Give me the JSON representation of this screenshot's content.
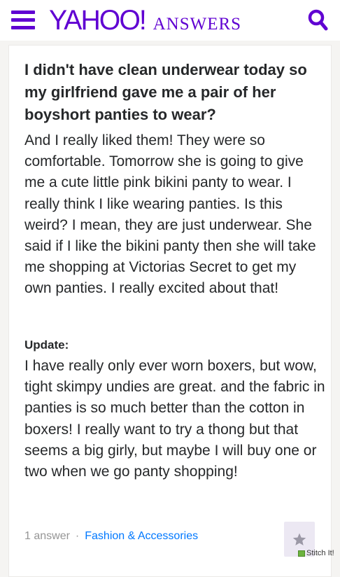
{
  "header": {
    "logo_main": "YAHOO!",
    "logo_sub": "ANSWERS",
    "menu_icon": "hamburger-menu-icon",
    "search_icon": "search-icon",
    "accent_color": "#6001d2"
  },
  "question": {
    "title": "I didn't have clean underwear today so my girlfriend gave me a pair of her boyshort panties to wear?",
    "body": "And I really liked them! They were so comfortable. Tomorrow she is going to give me a cute little pink bikini panty to wear. I really think I like wearing panties. Is this weird? I mean, they are just underwear. She said if I like the bikini panty then she will take me shopping at Victorias Secret to get my own panties. I really excited about that!",
    "update_label": "Update:",
    "update_body": "I have really only ever worn boxers, but wow, tight skimpy undies are great. and the fabric in panties is so much better than the cotton in boxers! I really want to try a thong but that seems a big girly, but maybe I will buy one or two when we go panty shopping!",
    "answer_count": "1 answer",
    "separator": "·",
    "category": "Fashion & Accessories",
    "category_color": "#0078ff",
    "star_icon": "star-icon"
  },
  "watermark": {
    "text": "Stitch It!"
  }
}
